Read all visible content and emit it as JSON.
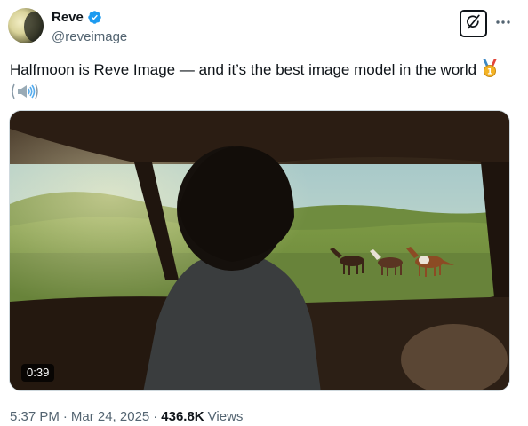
{
  "author": {
    "display_name": "Reve",
    "handle": "@reveimage",
    "verified": true,
    "avatar_icon": "half-moon-avatar"
  },
  "tweet": {
    "text": "Halfmoon is Reve Image — and it’s the best image model in the world",
    "emojis": [
      "first-place-medal",
      "speaker-high-volume"
    ]
  },
  "media": {
    "type": "video",
    "duration": "0:39"
  },
  "meta": {
    "time": "5:37 PM",
    "separator": "·",
    "date": "Mar 24, 2025",
    "views_count": "436.8K",
    "views_label": "Views"
  },
  "icons": {
    "grok": "grok-icon",
    "more": "more-horizontal-icon"
  },
  "colors": {
    "verified": "#1d9bf0",
    "text_primary": "#0f1419",
    "text_secondary": "#536471"
  }
}
